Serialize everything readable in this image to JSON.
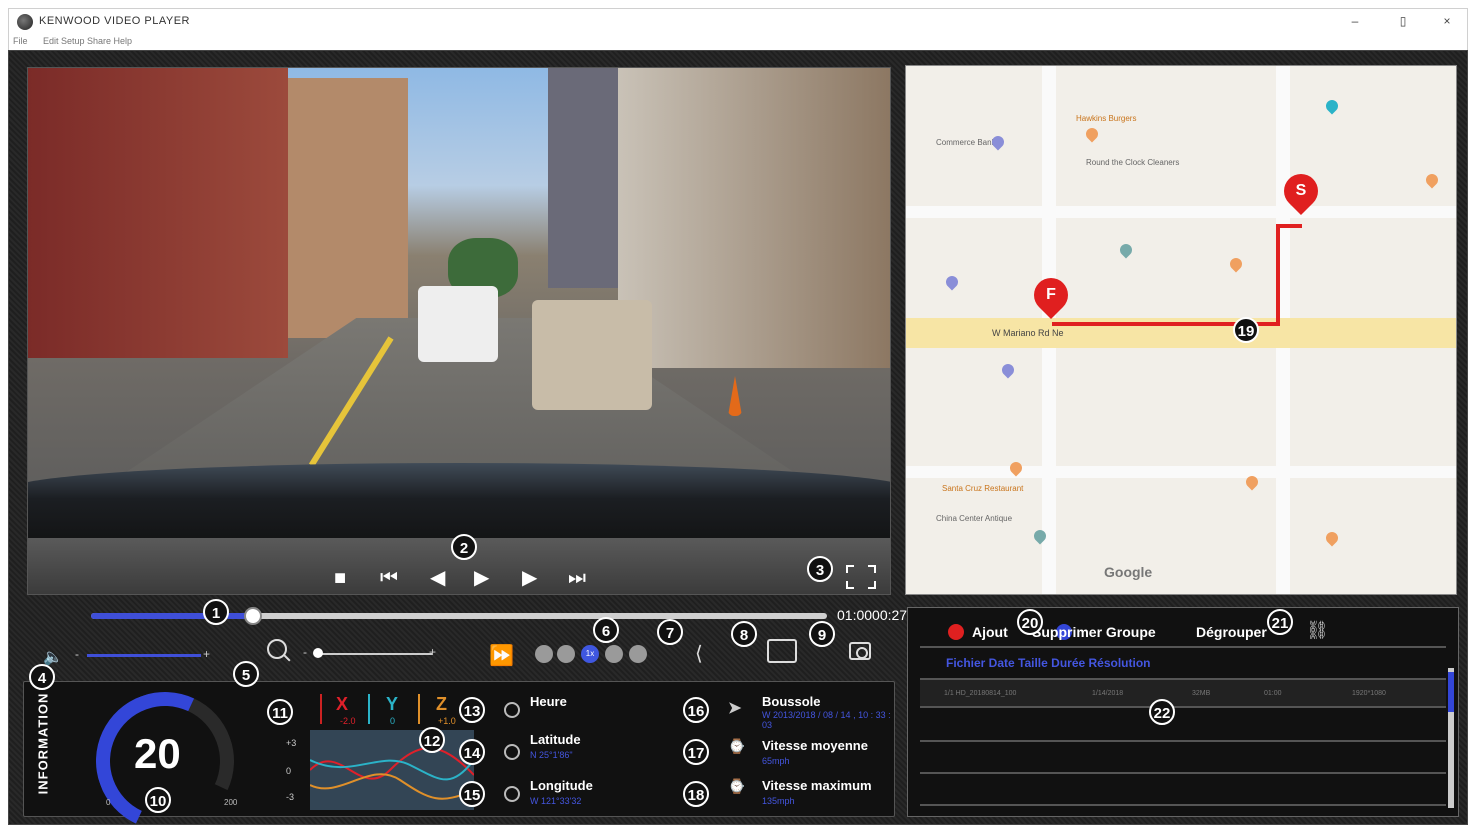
{
  "window": {
    "title": "KENWOOD VIDEO PLAYER",
    "minimize": "–",
    "maximize": "▯",
    "close": "×"
  },
  "menu": {
    "file": "File",
    "rest": "Edit Setup Share Help"
  },
  "player": {
    "timecode": "01:0000:27",
    "progress": 0.22,
    "volume": 0.85,
    "zoom": 0.0
  },
  "badges": [
    "1",
    "2",
    "3",
    "4",
    "5",
    "6",
    "7",
    "8",
    "9",
    "10",
    "11",
    "12",
    "13",
    "14",
    "15",
    "16",
    "17",
    "18",
    "19",
    "20",
    "21",
    "22"
  ],
  "map": {
    "start_pin": "S",
    "end_pin": "F",
    "main_road": "W Mariano Rd Ne",
    "google": "Google",
    "labels": [
      "Commerce Bank",
      "Hawkins Burgers",
      "Round the Clock Cleaners",
      "China Center Antique",
      "Santa Cruz Restaurant"
    ]
  },
  "info": {
    "title": "INFORMATION",
    "speed": "20",
    "speed_min": "0",
    "speed_max": "200",
    "gsensor": {
      "x_label": "X",
      "y_label": "Y",
      "z_label": "Z",
      "x_val": "-2.0",
      "y_val": "0",
      "z_val": "+1.0",
      "ticks": [
        "+3",
        "0",
        "-3"
      ]
    },
    "heure_label": "Heure",
    "latitude_label": "Latitude",
    "latitude_value": "N 25°1'86\"",
    "longitude_label": "Longitude",
    "longitude_value": "W 121°33'32",
    "boussole_label": "Boussole",
    "boussole_value": "W    2013/2018 / 08 / 14 ,   10 : 33 : 03",
    "vitesse_moy_label": "Vitesse moyenne",
    "vitesse_moy_value": "65mph",
    "vitesse_max_label": "Vitesse maximum",
    "vitesse_max_value": "135mph"
  },
  "files": {
    "ajout": "Ajout",
    "supprimer": "Supprimer Groupe",
    "degrouper": "Dégrouper",
    "headers": "Fichier Date Taille Durée Résolution",
    "row": [
      "1/1 HD_20180814_100",
      "1/14/2018",
      "32MB",
      "01:00",
      "1920*1080"
    ]
  },
  "colors": {
    "accent": "#3f4fd8",
    "route": "#e02020",
    "badge": "#111111"
  }
}
